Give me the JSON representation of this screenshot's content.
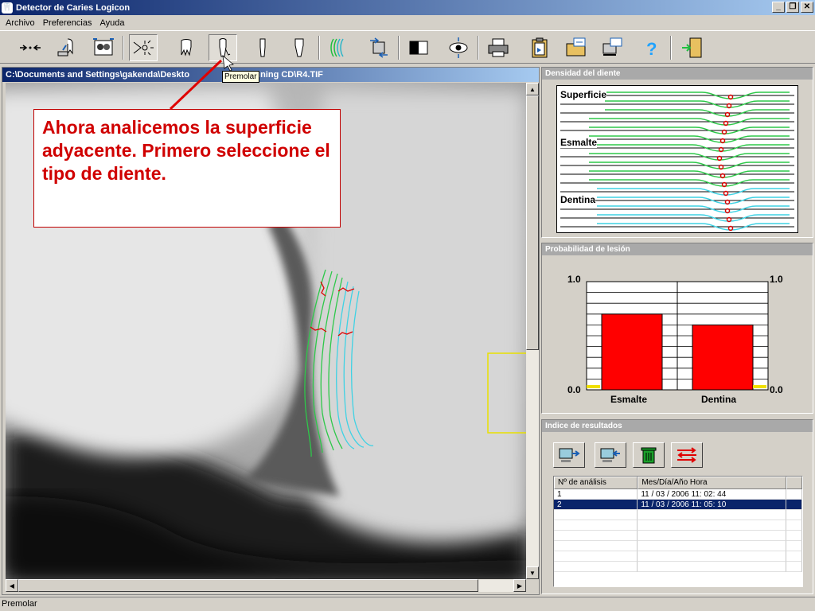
{
  "window": {
    "title": "Detector de Caries Logicon",
    "min": "_",
    "restore": "❐",
    "close": "✕"
  },
  "menu": [
    "Archivo",
    "Preferencias",
    "Ayuda"
  ],
  "toolbar": {
    "tooltip": "Premolar",
    "tools": [
      {
        "name": "calibrate-tool",
        "icon": "arrows-icon"
      },
      {
        "name": "select-tooth-tool",
        "icon": "hand-tooth-icon"
      },
      {
        "name": "patient-tool",
        "icon": "faces-icon"
      },
      {
        "name": "analyze-tool",
        "icon": "starburst-icon"
      },
      {
        "name": "molar-tool",
        "icon": "molar-icon"
      },
      {
        "name": "premolar-tool",
        "icon": "premolar-icon"
      },
      {
        "name": "canine-tool",
        "icon": "canine-icon"
      },
      {
        "name": "incisor-tool",
        "icon": "incisor-icon"
      },
      {
        "name": "surface-tool",
        "icon": "surface-lines-icon"
      },
      {
        "name": "import-tool",
        "icon": "import-icon"
      },
      {
        "name": "contrast-tool",
        "icon": "contrast-icon"
      },
      {
        "name": "view-tool",
        "icon": "eye-icon"
      },
      {
        "name": "print-tool",
        "icon": "printer-icon"
      },
      {
        "name": "report-tool",
        "icon": "clipboard-icon"
      },
      {
        "name": "export-tool",
        "icon": "folder-export-icon"
      },
      {
        "name": "export2-tool",
        "icon": "computer-export-icon"
      },
      {
        "name": "help-tool",
        "icon": "help-icon"
      },
      {
        "name": "exit-tool",
        "icon": "exit-door-icon"
      }
    ]
  },
  "image_window": {
    "path_left": "C:\\Documents and Settings\\gakenda\\Deskto",
    "path_right": "ar Training CD\\R4.TIF"
  },
  "callout": {
    "text": "Ahora analicemos la superficie adyacente. Primero seleccione el tipo de diente."
  },
  "density_panel": {
    "title": "Densidad del diente",
    "labels": [
      "Superficie",
      "Esmalte",
      "Dentina"
    ]
  },
  "probability_panel": {
    "title": "Probabilidad de lesión",
    "top_left": "1.0",
    "top_right": "1.0",
    "bottom_left": "0.0",
    "bottom_right": "0.0",
    "chart_data": {
      "type": "bar",
      "categories": [
        "Esmalte",
        "Dentina"
      ],
      "values": [
        0.7,
        0.6
      ],
      "ylim": [
        0,
        1
      ],
      "bar_color": "#ff0000"
    }
  },
  "results_panel": {
    "title": "Indice de resultados",
    "columns": [
      "Nº de análisis",
      "Mes/Día/Año  Hora"
    ],
    "rows": [
      {
        "num": "1",
        "datetime": "11 / 03 / 2006   11: 02: 44"
      },
      {
        "num": "2",
        "datetime": "11 / 03 / 2006   11: 05: 10"
      }
    ]
  },
  "statusbar": {
    "text": "Premolar"
  }
}
